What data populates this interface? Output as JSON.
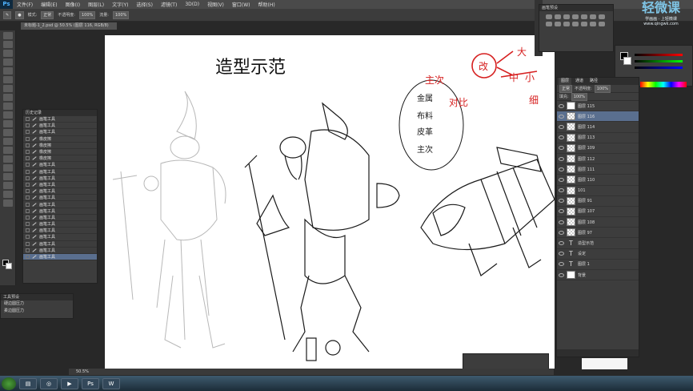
{
  "app": {
    "logo": "Ps"
  },
  "menu": [
    "文件(F)",
    "编辑(E)",
    "图像(I)",
    "图层(L)",
    "文字(Y)",
    "选择(S)",
    "滤镜(T)",
    "3D(D)",
    "视图(V)",
    "窗口(W)",
    "帮助(H)"
  ],
  "options": {
    "mode_label": "模式:",
    "mode_value": "正常",
    "opacity_label": "不透明度:",
    "opacity_value": "100%",
    "flow_label": "流量:",
    "flow_value": "100%"
  },
  "document": {
    "tab_title": "未标题-1_2.psd @ 50.5% (图层 116, RGB/8)"
  },
  "canvas": {
    "title": "造型示范",
    "annotation_main": "主次",
    "annotation_contrast": "对比",
    "annotation_change": "改",
    "annotation_large": "大",
    "annotation_medium": "中",
    "annotation_small": "小",
    "annotation_fine": "细",
    "bubble_lines": [
      "金属",
      "布料",
      "皮革",
      "主次"
    ]
  },
  "history_panel": {
    "title": "历史记录",
    "rows": [
      "画笔工具",
      "画笔工具",
      "画笔工具",
      "橡皮擦",
      "橡皮擦",
      "橡皮擦",
      "橡皮擦",
      "画笔工具",
      "画笔工具",
      "画笔工具",
      "画笔工具",
      "画笔工具",
      "画笔工具",
      "画笔工具",
      "画笔工具",
      "画笔工具",
      "画笔工具",
      "画笔工具",
      "画笔工具",
      "画笔工具",
      "画笔工具",
      "画笔工具"
    ]
  },
  "tool_panel": {
    "title": "工具预设",
    "rows": [
      "硬边圆压力",
      "柔边圆压力"
    ]
  },
  "brush_panel": {
    "title": "画笔预设"
  },
  "layers_panel": {
    "tabs": [
      "图层",
      "通道",
      "路径"
    ],
    "blend": "正常",
    "opacity_label": "不透明度:",
    "opacity_value": "100%",
    "fill_label": "填充:",
    "fill_value": "100%",
    "rows": [
      {
        "name": "图层 115",
        "kind": "white"
      },
      {
        "name": "图层 116",
        "kind": "checker",
        "selected": true
      },
      {
        "name": "图层 114",
        "kind": "checker"
      },
      {
        "name": "图层 113",
        "kind": "checker"
      },
      {
        "name": "图层 109",
        "kind": "checker"
      },
      {
        "name": "图层 112",
        "kind": "checker"
      },
      {
        "name": "图层 111",
        "kind": "checker"
      },
      {
        "name": "图层 110",
        "kind": "checker"
      },
      {
        "name": "101",
        "kind": "checker"
      },
      {
        "name": "图层 91",
        "kind": "checker"
      },
      {
        "name": "图层 107",
        "kind": "checker"
      },
      {
        "name": "图层 108",
        "kind": "checker"
      },
      {
        "name": "图层 97",
        "kind": "checker"
      },
      {
        "name": "造型示范",
        "kind": "text"
      },
      {
        "name": "设定",
        "kind": "text"
      },
      {
        "name": "图层 1",
        "kind": "text"
      },
      {
        "name": "背景",
        "kind": "white"
      }
    ]
  },
  "status": {
    "zoom": "50.5%"
  },
  "watermark": {
    "title": "轻微课",
    "subtitle": "学画画 · 上轻微课",
    "url": "www.qingwk.com"
  },
  "colors": {
    "accent_red": "#d62020",
    "selection": "#5a6f8f"
  }
}
